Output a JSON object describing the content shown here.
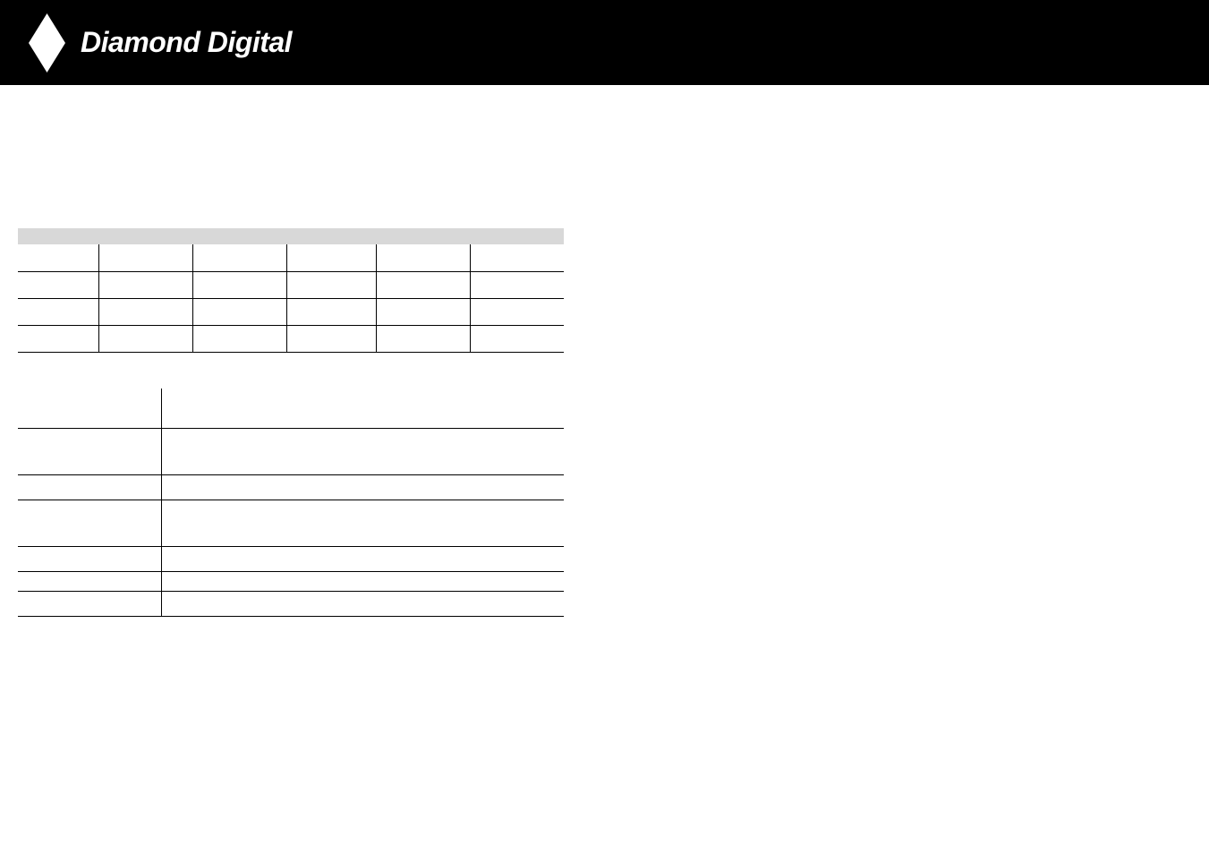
{
  "header": {
    "brand": "Diamond Digital"
  },
  "table1": {
    "header_shaded": true,
    "rows": [
      [
        "",
        "",
        "",
        "",
        "",
        ""
      ],
      [
        "",
        "",
        "",
        "",
        "",
        ""
      ],
      [
        "",
        "",
        "",
        "",
        "",
        ""
      ],
      [
        "",
        "",
        "",
        "",
        "",
        ""
      ]
    ]
  },
  "table2": {
    "rows": [
      [
        "",
        ""
      ],
      [
        "",
        ""
      ],
      [
        "",
        ""
      ],
      [
        "",
        ""
      ],
      [
        "",
        ""
      ],
      [
        "",
        ""
      ],
      [
        "",
        ""
      ]
    ]
  }
}
